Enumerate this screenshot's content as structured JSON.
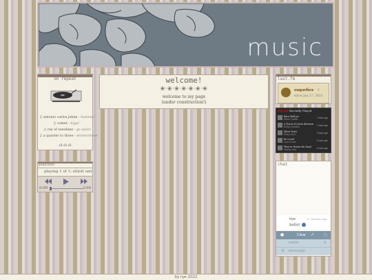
{
  "banner": {
    "title": "music"
  },
  "on_repeat": {
    "heading": "on repeat",
    "tracks": [
      {
        "title": "antonio carlos jobim",
        "artist": "hummer"
      },
      {
        "title": "comet",
        "artist": "kigaf"
      },
      {
        "title": "ray of sunshine",
        "artist": "go sailor"
      },
      {
        "title": "a quarter to three",
        "artist": "dexter/stone"
      }
    ],
    "footer": "·ıll·ıll·ıll·"
  },
  "playlists": {
    "heading": "playlists",
    "now_playing": "playing 1 of 1: elliott smith",
    "time_current": "0:00",
    "time_total": "3:09",
    "progress": 0.0
  },
  "welcome": {
    "heading": "welcome!",
    "divider": "❀·❀·❀·❀·❀·❀·❀",
    "line1": "welcome to my page",
    "line2": "(under construction!)"
  },
  "lastfm": {
    "heading": "last.fm",
    "user": "sugarfiex",
    "count": "1",
    "since": "since jan 27, 2021",
    "recent_label": "Recently Played",
    "brand": "last.fm",
    "tracks": [
      {
        "title": "Barn Mall Joe",
        "artist": "Elliott Smith",
        "ago": "1 min ago"
      },
      {
        "title": "A Touch of Green Between",
        "artist": "Kitten Harden",
        "ago": "2 min ago"
      },
      {
        "title": "Silver Tears",
        "artist": "Fairy Dove",
        "ago": "4 min ago"
      },
      {
        "title": "Be Loved",
        "artist": "Luna Frost",
        "ago": "6 min ago"
      },
      {
        "title": "They've Drawn the Road",
        "artist": "Mazzy Star",
        "ago": "8 min ago"
      }
    ]
  },
  "chat": {
    "heading": "chat",
    "messages": [
      {
        "user": "rye",
        "time": "12 months ago",
        "text": "hello!"
      }
    ],
    "clear_label": "Clear",
    "name_placeholder": "name",
    "message_placeholder": "message"
  },
  "footer": {
    "text": "by rye 2022"
  },
  "colors": {
    "accent": "#8a7a6e",
    "panel": "#f4f0e4",
    "lastfm_red": "#d51007"
  }
}
